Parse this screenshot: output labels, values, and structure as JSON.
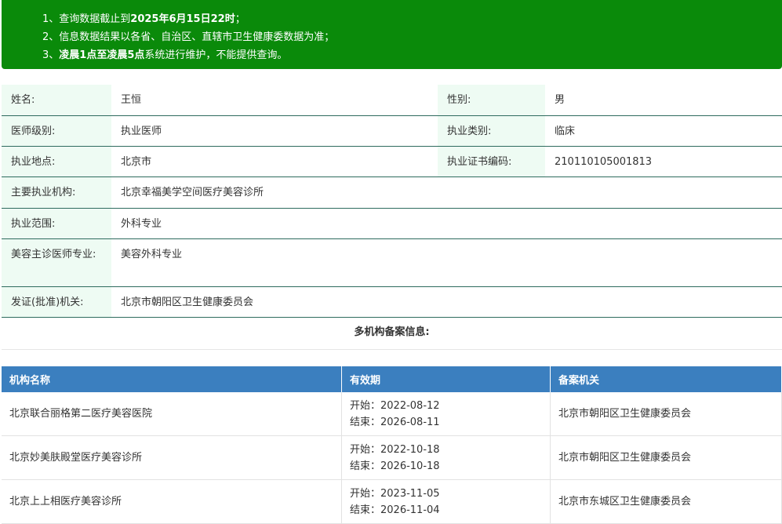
{
  "notice": {
    "line1_prefix": "1、查询数据截止到",
    "line1_bold": "2025年6月15日22时",
    "line1_suffix": "；",
    "line2": "2、信息数据结果以各省、自治区、直辖市卫生健康委数据为准；",
    "line3_prefix": "3、",
    "line3_bold": "凌晨1点至凌晨5点",
    "line3_suffix": "系统进行维护，不能提供查询。"
  },
  "doctor": {
    "name_label": "姓名:",
    "name": "王恒",
    "gender_label": "性别:",
    "gender": "男",
    "level_label": "医师级别:",
    "level": "执业医师",
    "category_label": "执业类别:",
    "category": "临床",
    "location_label": "执业地点:",
    "location": "北京市",
    "cert_label": "执业证书编码:",
    "cert": "210110105001813",
    "institution_label": "主要执业机构:",
    "institution": "北京幸福美学空间医疗美容诊所",
    "scope_label": "执业范围:",
    "scope": "外科专业",
    "specialty_label": "美容主诊医师专业:",
    "specialty": "美容外科专业",
    "issuer_label": "发证(批准)机关:",
    "issuer": "北京市朝阳区卫生健康委员会"
  },
  "multi_title": "多机构备案信息:",
  "table": {
    "headers": [
      "机构名称",
      "有效期",
      "备案机关"
    ],
    "rows": [
      {
        "name": "北京联合丽格第二医疗美容医院",
        "start": "开始：2022-08-12",
        "end": "结束：2026-08-11",
        "authority": "北京市朝阳区卫生健康委员会"
      },
      {
        "name": "北京妙美肤殿堂医疗美容诊所",
        "start": "开始：2022-10-18",
        "end": "结束：2026-10-18",
        "authority": "北京市朝阳区卫生健康委员会"
      },
      {
        "name": "北京上上相医疗美容诊所",
        "start": "开始：2023-11-05",
        "end": "结束：2026-11-04",
        "authority": "北京市东城区卫生健康委员会"
      }
    ]
  }
}
